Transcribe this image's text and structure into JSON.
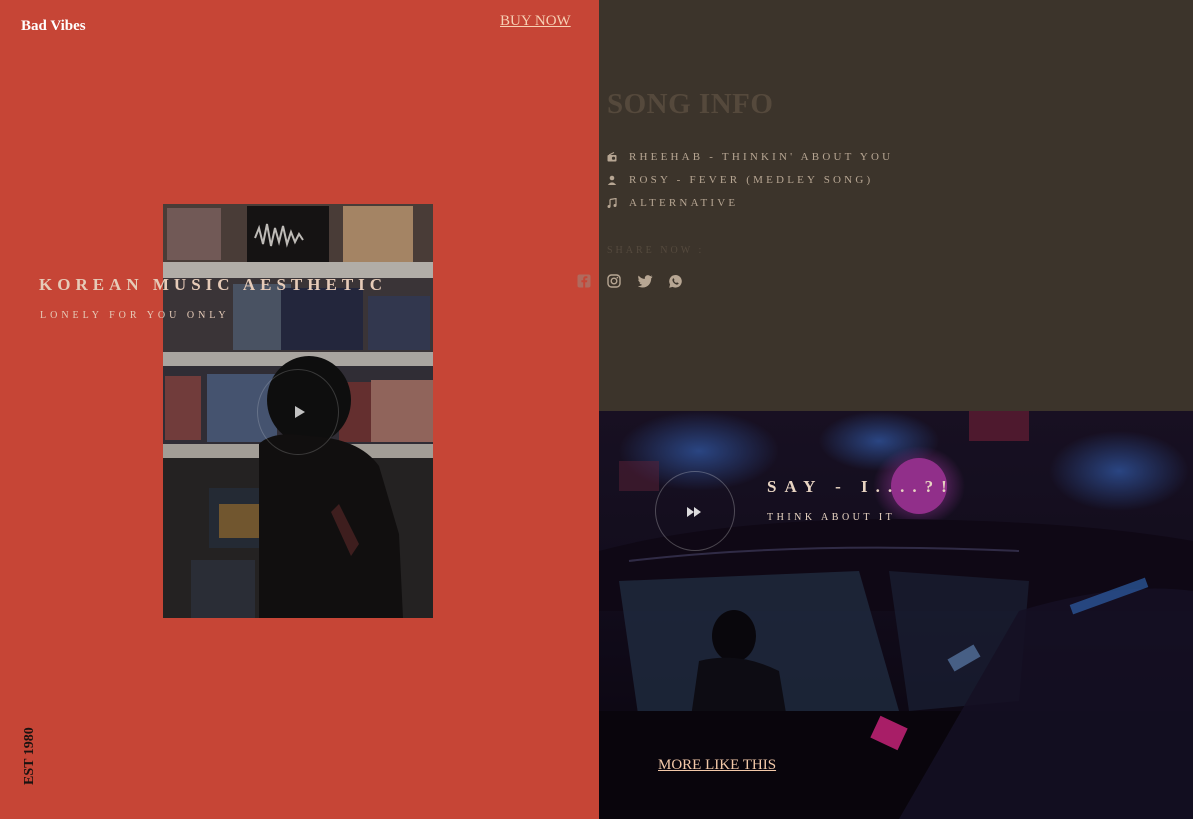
{
  "header": {
    "brand": "Bad Vibes",
    "buy_label": "BUY NOW"
  },
  "hero": {
    "title": "KOREAN MUSIC AESTHETIC",
    "subtitle": "LONELY FOR YOU ONLY"
  },
  "footer_left": {
    "est": "EST 1980"
  },
  "song_info": {
    "title": "SONG INFO",
    "items": [
      {
        "icon": "radio-icon",
        "text": "RHEEHAB - THINKIN' ABOUT YOU"
      },
      {
        "icon": "user-icon",
        "text": "ROSY - FEVER (MEDLEY SONG)"
      },
      {
        "icon": "music-note-icon",
        "text": "ALTERNATIVE"
      }
    ],
    "share_label": "SHARE NOW :",
    "social": [
      "facebook-icon",
      "instagram-icon",
      "twitter-icon",
      "whatsapp-icon"
    ]
  },
  "feature": {
    "title": "SAY - I....?!",
    "subtitle": "THINK ABOUT IT",
    "more_label": "MORE LIKE THIS"
  },
  "colors": {
    "left_bg": "#c64536",
    "right_top_bg": "#3c342b",
    "accent_link": "#f7d0b4"
  }
}
